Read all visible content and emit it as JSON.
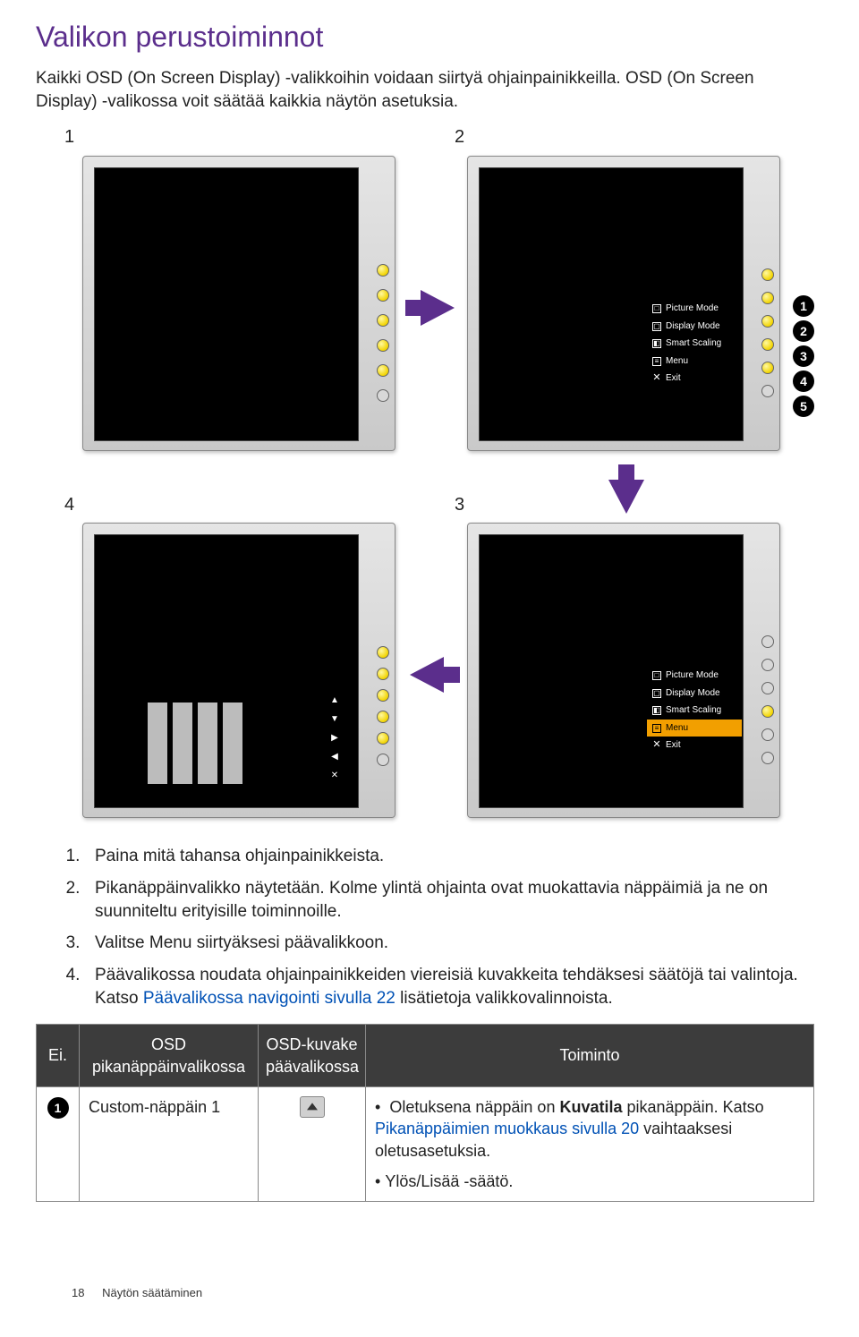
{
  "title": "Valikon perustoiminnot",
  "intro": "Kaikki OSD (On Screen Display) -valikkoihin voidaan siirtyä ohjainpainikkeilla. OSD (On Screen Display) -valikossa voit säätää kaikkia näytön asetuksia.",
  "step_labels": {
    "s1": "1",
    "s2": "2",
    "s3": "3",
    "s4": "4"
  },
  "callouts": {
    "c1": "1",
    "c2": "2",
    "c3": "3",
    "c4": "4",
    "c5": "5"
  },
  "osd": {
    "picture_mode": "Picture Mode",
    "display_mode": "Display Mode",
    "smart_scaling": "Smart Scaling",
    "menu": "Menu",
    "exit": "Exit"
  },
  "steps": {
    "l1": "Paina mitä tahansa ohjainpainikkeista.",
    "l2": "Pikanäppäinvalikko näytetään. Kolme ylintä ohjainta ovat muokattavia näppäimiä ja ne on suunniteltu erityisille toiminnoille.",
    "l3a": "Valitse ",
    "l3b": "Menu",
    "l3c": " siirtyäksesi päävalikkoon.",
    "l4a": "Päävalikossa noudata ohjainpainikkeiden viereisiä kuvakkeita tehdäksesi säätöjä tai valintoja. Katso ",
    "l4b": "Päävalikossa navigointi sivulla 22",
    "l4c": " lisätietoja valikkovalinnoista."
  },
  "table": {
    "head_ei": "Ei.",
    "head_osd_hk": "OSD pikanäppäinvalikossa",
    "head_osd_icon": "OSD-kuvake päävalikossa",
    "head_func": "Toiminto",
    "row1": {
      "num": "1",
      "hk": "Custom-näppäin 1",
      "b1_a": "Oletuksena näppäin on ",
      "b1_b": "Kuvatila",
      "b1_c": " pikanäppäin. Katso ",
      "b1_link": "Pikanäppäimien muokkaus sivulla 20",
      "b1_d": " vaihtaaksesi oletusasetuksia.",
      "b2": "Ylös/Lisää -säätö."
    }
  },
  "footer": {
    "page": "18",
    "section": "Näytön säätäminen"
  }
}
